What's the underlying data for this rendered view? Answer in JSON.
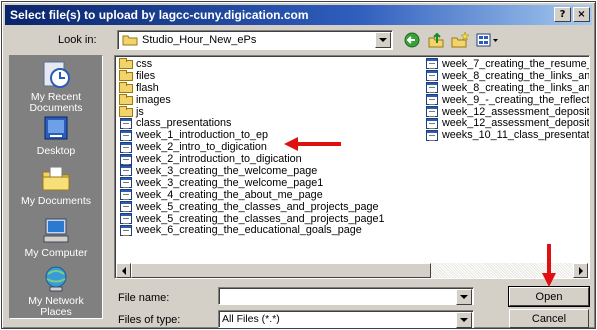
{
  "window": {
    "title": "Select file(s) to upload by lagcc-cuny.digication.com",
    "help_btn": "?",
    "close_btn": "×"
  },
  "toolbar": {
    "look_in_label": "Look in:",
    "look_in_value": "Studio_Hour_New_ePs",
    "icons": [
      "back-icon",
      "up-folder-icon",
      "new-folder-icon",
      "views-menu-icon"
    ]
  },
  "places": [
    {
      "label_line1": "My Recent",
      "label_line2": "Documents",
      "icon": "recent-documents-icon"
    },
    {
      "label_line1": "Desktop",
      "label_line2": "",
      "icon": "desktop-icon"
    },
    {
      "label_line1": "My Documents",
      "label_line2": "",
      "icon": "my-documents-icon"
    },
    {
      "label_line1": "My Computer",
      "label_line2": "",
      "icon": "my-computer-icon"
    },
    {
      "label_line1": "My Network",
      "label_line2": "Places",
      "icon": "network-places-icon"
    }
  ],
  "files_col1": [
    {
      "name": "css",
      "type": "folder"
    },
    {
      "name": "files",
      "type": "folder"
    },
    {
      "name": "flash",
      "type": "folder"
    },
    {
      "name": "images",
      "type": "folder"
    },
    {
      "name": "js",
      "type": "folder"
    },
    {
      "name": "class_presentations",
      "type": "htm"
    },
    {
      "name": "week_1_introduction_to_ep",
      "type": "htm"
    },
    {
      "name": "week_2_intro_to_digication",
      "type": "htm"
    },
    {
      "name": "week_2_introduction_to_digication",
      "type": "htm"
    },
    {
      "name": "week_3_creating_the_welcome_page",
      "type": "htm"
    },
    {
      "name": "week_3_creating_the_welcome_page1",
      "type": "htm"
    },
    {
      "name": "week_4_creating_the_about_me_page",
      "type": "htm"
    },
    {
      "name": "week_5_creating_the_classes_and_projects_page",
      "type": "htm"
    },
    {
      "name": "week_5_creating_the_classes_and_projects_page1",
      "type": "htm"
    },
    {
      "name": "week_6_creating_the_educational_goals_page",
      "type": "htm"
    }
  ],
  "files_col2": [
    {
      "name": "week_7_creating_the_resume_",
      "type": "htm"
    },
    {
      "name": "week_8_creating_the_links_anc",
      "type": "htm"
    },
    {
      "name": "week_8_creating_the_links_anc",
      "type": "htm"
    },
    {
      "name": "week_9_-_creating_the_reflect",
      "type": "htm"
    },
    {
      "name": "week_12_assessment_depositir",
      "type": "htm"
    },
    {
      "name": "week_12_assessment_depositin",
      "type": "htm"
    },
    {
      "name": "weeks_10_11_class_presentati",
      "type": "htm"
    }
  ],
  "form": {
    "file_name_label": "File name:",
    "file_name_value": "",
    "files_of_type_label": "Files of type:",
    "files_of_type_value": "All Files (*.*)",
    "open_label": "Open",
    "cancel_label": "Cancel"
  },
  "annotations": {
    "arrow_color": "#e01010"
  }
}
